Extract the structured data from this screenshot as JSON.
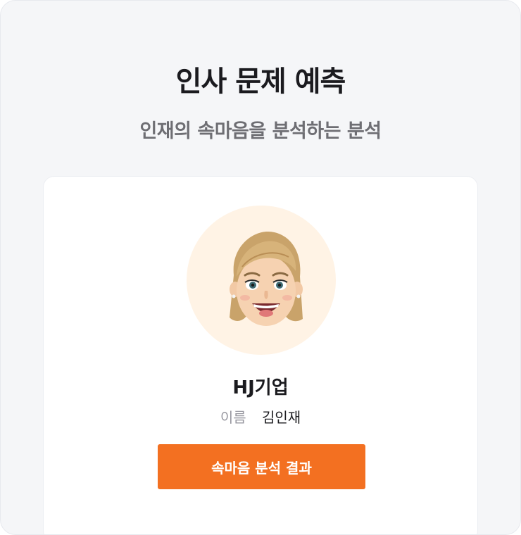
{
  "header": {
    "title": "인사 문제 예측",
    "subtitle": "인재의 속마음을 분석하는 분석"
  },
  "card": {
    "avatar_icon": "memoji-woman-avatar-icon",
    "company": "HJ기업",
    "name_label": "이름",
    "name_value": "김인재",
    "button_label": "속마음 분석 결과"
  },
  "colors": {
    "page_bg": "#f5f6f8",
    "card_bg": "#ffffff",
    "avatar_bg": "#fff3e5",
    "accent": "#f37021",
    "title_text": "#1b1b1f",
    "subtitle_text": "#6e6e73",
    "muted_text": "#9a9aa2"
  }
}
